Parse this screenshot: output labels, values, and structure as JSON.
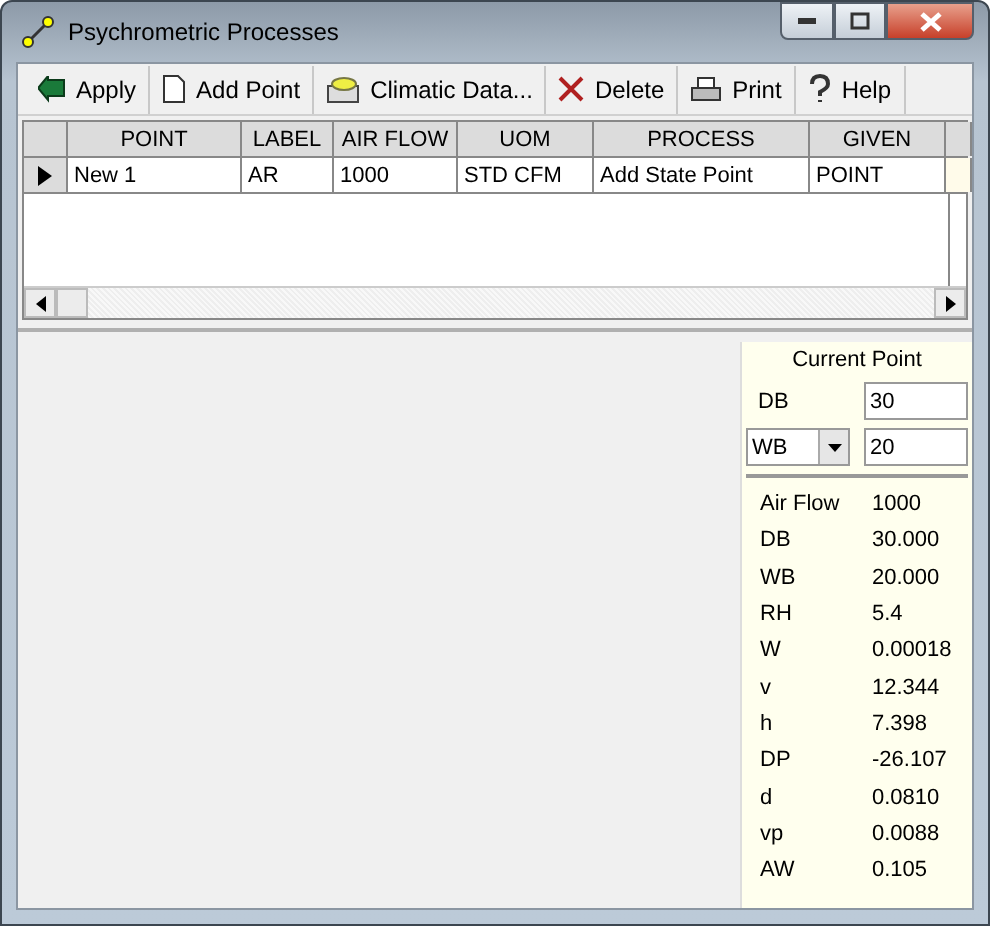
{
  "window": {
    "title": "Psychrometric Processes"
  },
  "toolbar": [
    {
      "kind": "apply",
      "label": "Apply"
    },
    {
      "kind": "add",
      "label": "Add Point"
    },
    {
      "kind": "climate",
      "label": "Climatic Data..."
    },
    {
      "kind": "delete",
      "label": "Delete"
    },
    {
      "kind": "print",
      "label": "Print"
    },
    {
      "kind": "help",
      "label": "Help"
    }
  ],
  "table": {
    "columns": [
      "POINT",
      "LABEL",
      "AIR FLOW",
      "UOM",
      "PROCESS",
      "GIVEN"
    ],
    "rows": [
      {
        "selected": true,
        "cells": [
          "New 1",
          "AR",
          "1000",
          "STD CFM",
          "Add State Point",
          "POINT"
        ]
      }
    ]
  },
  "current_point": {
    "title": "Current Point",
    "db_label": "DB",
    "db_value": "30",
    "wb_select": "WB",
    "wb_value": "20"
  },
  "properties": [
    {
      "name": "Air Flow",
      "value": "1000"
    },
    {
      "name": "DB",
      "value": "30.000"
    },
    {
      "name": "WB",
      "value": "20.000"
    },
    {
      "name": "RH",
      "value": "5.4"
    },
    {
      "name": "W",
      "value": "0.00018"
    },
    {
      "name": "v",
      "value": "12.344"
    },
    {
      "name": "h",
      "value": "7.398"
    },
    {
      "name": "DP",
      "value": "-26.107"
    },
    {
      "name": "d",
      "value": "0.0810"
    },
    {
      "name": "vp",
      "value": "0.0088"
    },
    {
      "name": "AW",
      "value": "0.105"
    }
  ]
}
